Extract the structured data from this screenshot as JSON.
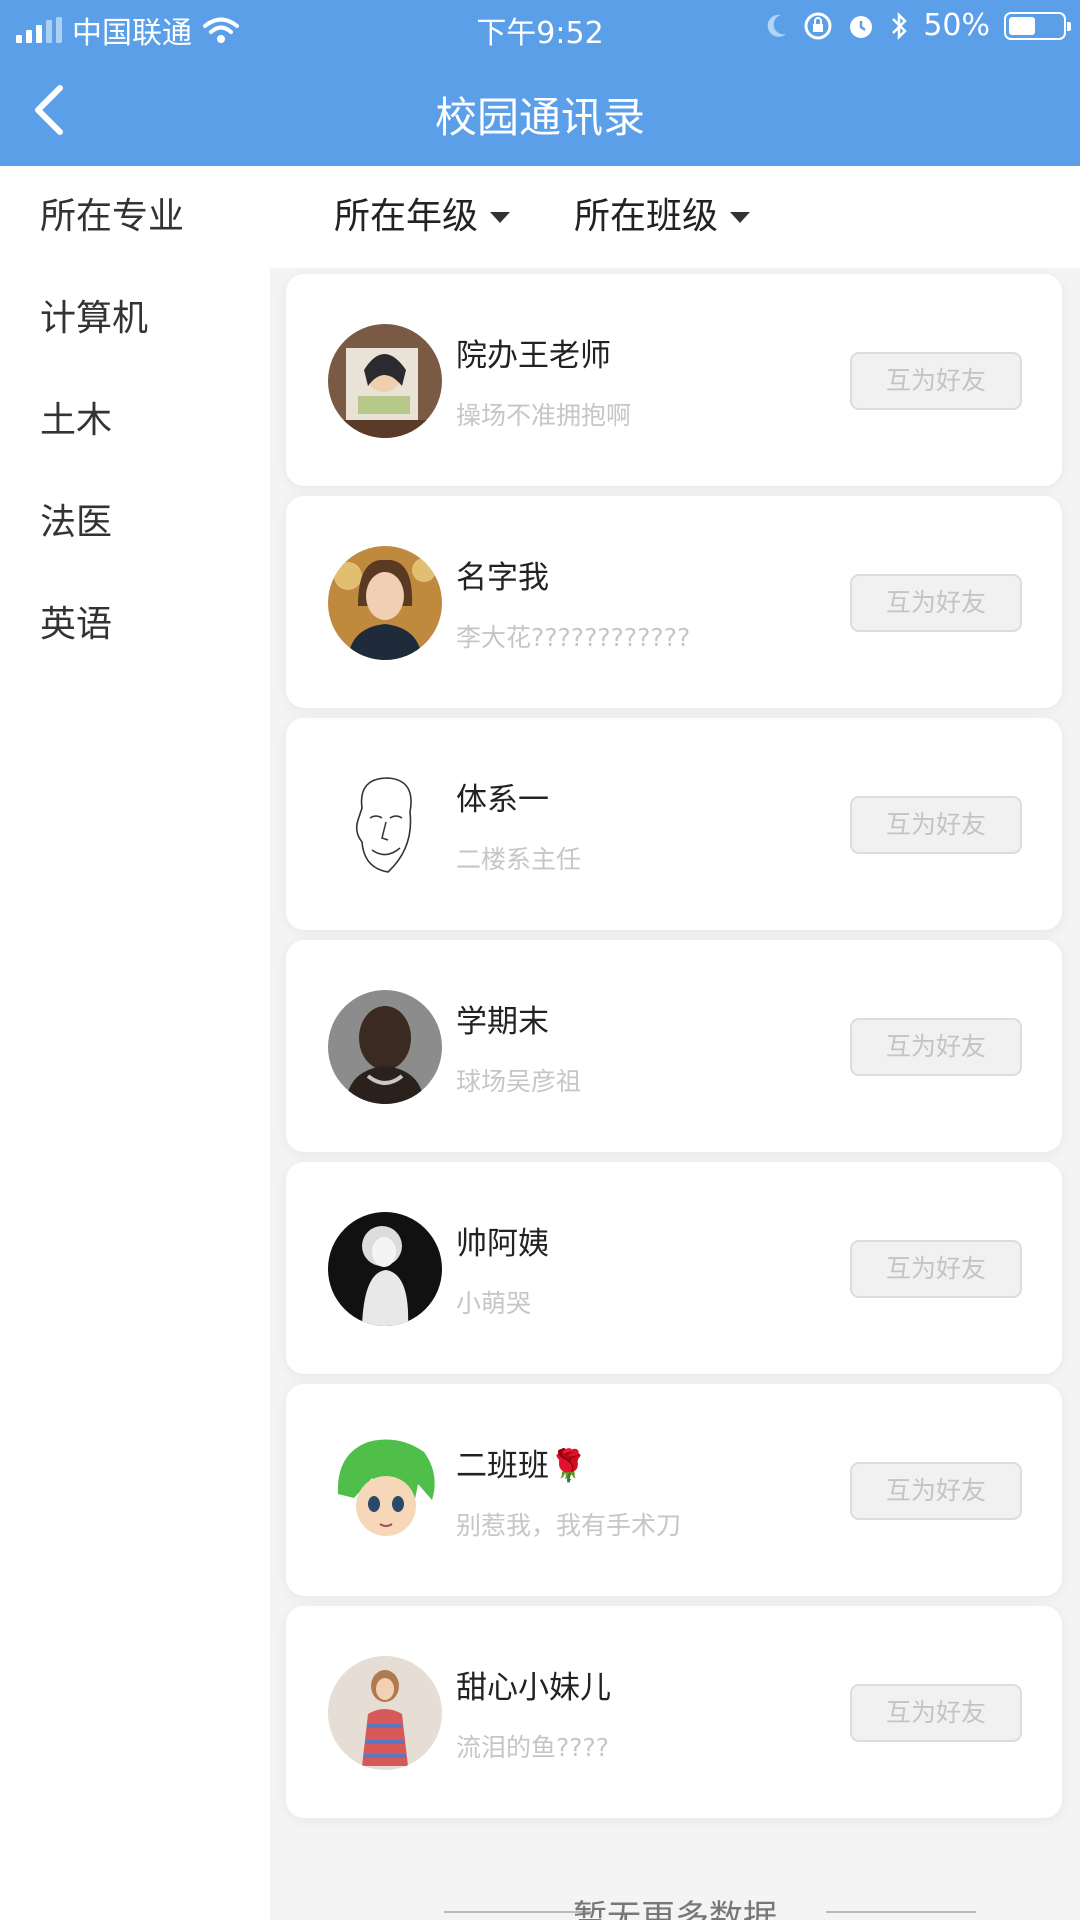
{
  "status_bar": {
    "carrier": "中国联通",
    "time": "下午9:52",
    "battery_text": "50%",
    "battery_level": 0.5,
    "icons": [
      "signal-icon",
      "wifi-icon",
      "moon-icon",
      "rotation-lock-icon",
      "alarm-icon",
      "bluetooth-icon",
      "battery-icon"
    ]
  },
  "nav": {
    "title": "校园通讯录",
    "back_icon": "chevron-left-icon"
  },
  "filters": {
    "major": "所在专业",
    "grade": "所在年级",
    "class": "所在班级"
  },
  "sidebar": {
    "items": [
      {
        "label": "计算机"
      },
      {
        "label": "土木"
      },
      {
        "label": "法医"
      },
      {
        "label": "英语"
      }
    ]
  },
  "contacts": [
    {
      "name": "院办王老师",
      "signature": "操场不准拥抱啊",
      "button": "互为好友",
      "avatar": "anime-girl-photo"
    },
    {
      "name": "名字我",
      "signature": "李大花????????????",
      "button": "互为好友",
      "avatar": "woman-portrait-photo"
    },
    {
      "name": "体系一",
      "signature": "二楼系主任",
      "button": "互为好友",
      "avatar": "sketch-face-drawing"
    },
    {
      "name": "学期末",
      "signature": "球场吴彦祖",
      "button": "互为好友",
      "avatar": "man-portrait-photo"
    },
    {
      "name": "帅阿姨",
      "signature": "小萌哭",
      "button": "互为好友",
      "avatar": "bw-portrait-photo"
    },
    {
      "name": "二班班🌹",
      "signature": "别惹我，我有手术刀",
      "button": "互为好友",
      "avatar": "green-hair-cartoon"
    },
    {
      "name": "甜心小妹儿",
      "signature": "流泪的鱼????",
      "button": "互为好友",
      "avatar": "woman-dress-photo"
    }
  ],
  "footer": {
    "text": "暂无更多数据"
  },
  "colors": {
    "header": "#5a9fe8",
    "sidebar": "#ffffff",
    "page_bg": "#f4f4f4"
  }
}
